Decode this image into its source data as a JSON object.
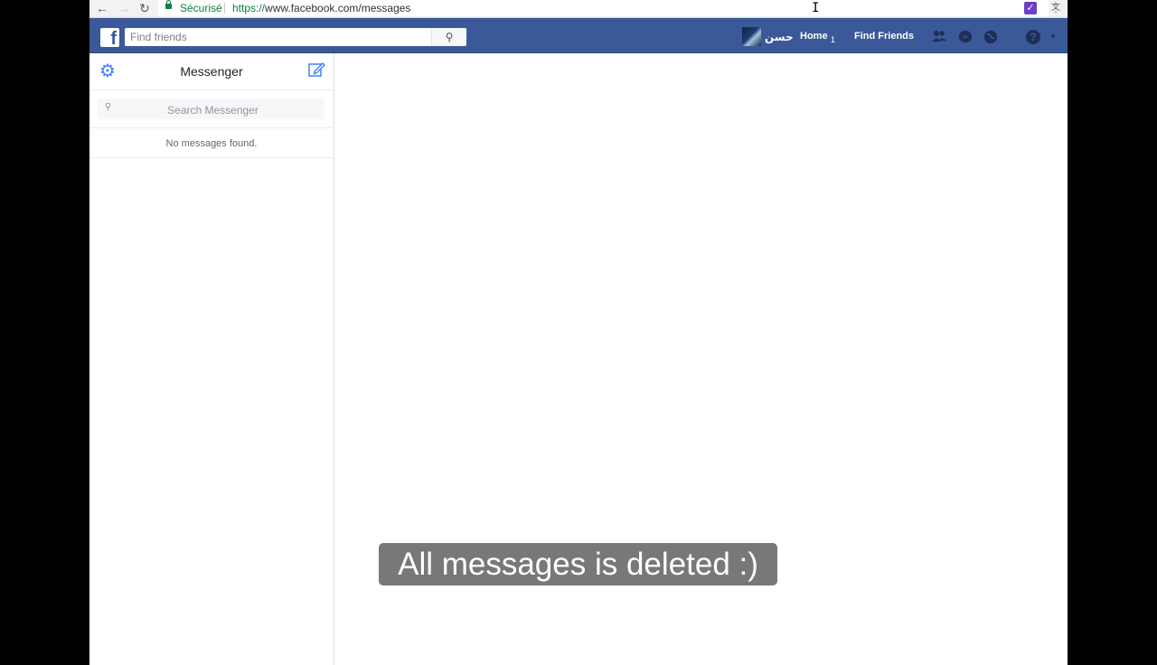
{
  "browser": {
    "security_label": "Sécurisé",
    "url_scheme": "https://",
    "url_rest": "www.facebook.com/messages",
    "icons": [
      "back-icon",
      "forward-icon",
      "reload-icon",
      "lock-icon",
      "translate-icon",
      "star-icon",
      "extension-icon",
      "menu-icon"
    ]
  },
  "facebook_bar": {
    "logo": "f",
    "search_placeholder": "Find friends",
    "profile_name": "حسن",
    "home_label": "Home",
    "home_count": "1",
    "find_friends_label": "Find Friends",
    "help_glyph": "?",
    "colors": {
      "bar": "#3b5998",
      "icons": "#1d2f58"
    }
  },
  "messenger": {
    "title": "Messenger",
    "search_placeholder": "Search Messenger",
    "empty_text": "No messages found.",
    "accent_color": "#4080ff"
  },
  "caption": {
    "text": "All messages is deleted :)"
  }
}
